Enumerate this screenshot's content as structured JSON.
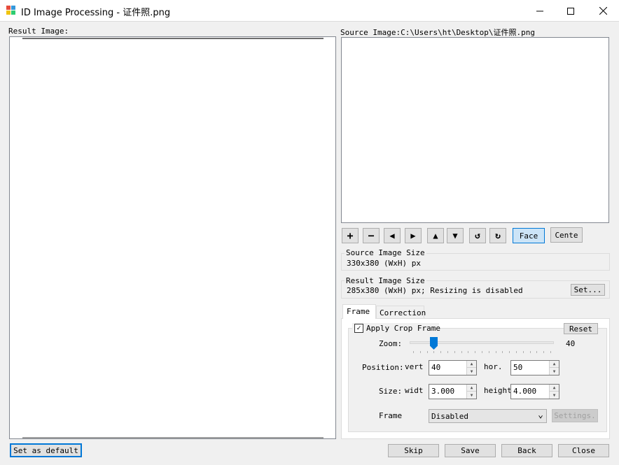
{
  "window": {
    "title": "ID Image Processing - 证件照.png",
    "app_icon": "app-icon",
    "controls": {
      "minimize": "–",
      "maximize": "☐",
      "close": "✕"
    }
  },
  "result": {
    "label": "Result Image:"
  },
  "source": {
    "label": "Source Image:C:\\Users\\ht\\Desktop\\证件照.png"
  },
  "toolbar": {
    "zoom_in": "+",
    "zoom_out": "−",
    "left": "◀",
    "right": "▶",
    "up": "▲",
    "down": "▼",
    "rotate_ccw": "↺",
    "rotate_cw": "↻",
    "face": "Face",
    "center": "Cente"
  },
  "source_size": {
    "title": "Source Image Size",
    "value": "330x380 (WxH) px"
  },
  "result_size": {
    "title": "Result Image Size",
    "value": "285x380 (WxH) px; Resizing is disabled",
    "set_button": "Set..."
  },
  "tabs": [
    {
      "label": "Frame",
      "active": true
    },
    {
      "label": "Correction",
      "active": false
    }
  ],
  "frame": {
    "apply_crop_label": "Apply Crop Frame",
    "apply_crop_checked": true,
    "checkmark": "✓",
    "reset_button": "Reset",
    "zoom_label": "Zoom:",
    "zoom_value": "40",
    "zoom_level": 0.15,
    "position_label": "Position:",
    "vert_label": "vert",
    "vert_value": "40",
    "hor_label": "hor.",
    "hor_value": "50",
    "size_label": "Size:",
    "width_label": "widt",
    "width_value": "3.000",
    "height_label": "height",
    "height_value": "4.000",
    "frame_label": "Frame",
    "frame_select_value": "Disabled",
    "settings_button": "Settings.",
    "spin_up": "▲",
    "spin_down": "▼",
    "dropdown_arrow": "⌄"
  },
  "bottom": {
    "set_default": "Set as default",
    "skip": "Skip",
    "save": "Save",
    "back": "Back",
    "close": "Close"
  },
  "colors": {
    "accent": "#0078d7",
    "face_button_bg": "#cce4f7",
    "window_bg": "#f0f0f0"
  }
}
